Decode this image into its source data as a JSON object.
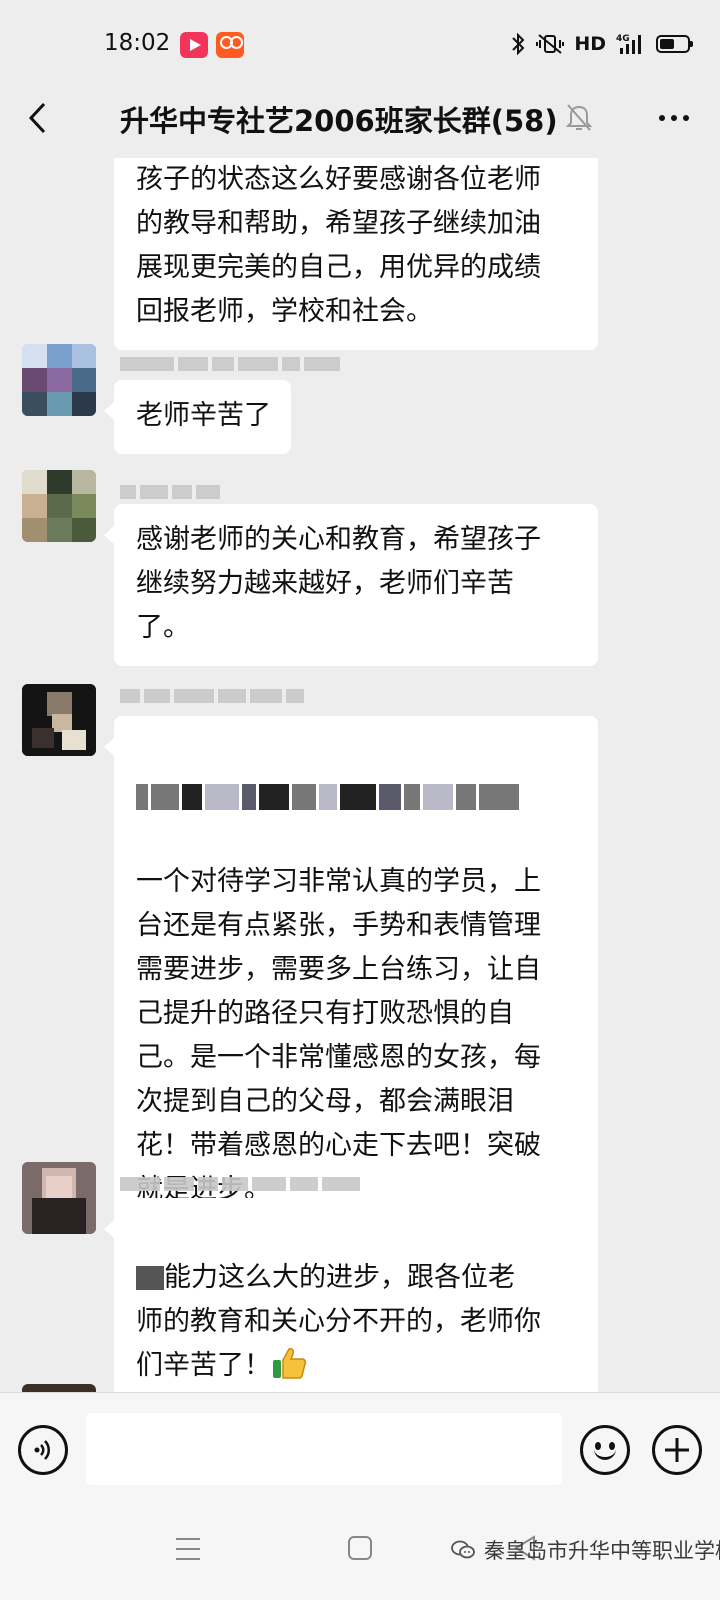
{
  "status_bar": {
    "time": "18:02",
    "hd_label": "HD",
    "network_label": "4G",
    "icons": [
      "video-app-icon",
      "kuaishou-app-icon",
      "bluetooth-icon",
      "vibrate-mute-icon",
      "signal-icon",
      "battery-icon"
    ]
  },
  "header": {
    "title": "升华中专社艺2006班家长群(58)",
    "icons": [
      "back-arrow-icon",
      "mute-bell-icon",
      "more-icon"
    ]
  },
  "messages": [
    {
      "text": "孩子的状态这么好要感谢各位老师\n的教导和帮助，希望孩子继续加油\n展现更完美的自己，用优异的成绩\n回报老师，学校和社会。"
    },
    {
      "text": "老师辛苦了"
    },
    {
      "text": "感谢老师的关心和教育，希望孩子\n继续努力越来越好，老师们辛苦\n了。"
    },
    {
      "text": "一个对待学习非常认真的学员，上\n台还是有点紧张，手势和表情管理\n需要进步，需要多上台练习，让自\n己提升的路径只有打败恐惧的自\n己。是一个非常懂感恩的女孩，每\n次提到自己的父母，都会满眼泪\n花！带着感恩的心走下去吧！突破\n就是进步。"
    },
    {
      "text_line1": "能力这么大的进步，跟各位老",
      "text_rest": "师的教育和关心分不开的，老师你\n们辛苦了！",
      "emoji": "thumbs-up-icon"
    }
  ],
  "input_bar": {
    "placeholder": "",
    "icons": [
      "voice-icon",
      "emoji-icon",
      "add-icon"
    ]
  },
  "nav_bar": {
    "watermark": "秦皇岛市升华中等职业学校",
    "icons": [
      "menu-icon",
      "home-icon",
      "back-icon",
      "wechat-channel-icon"
    ]
  },
  "colors": {
    "background": "#ededed",
    "bubble": "#ffffff",
    "text": "#111111"
  }
}
